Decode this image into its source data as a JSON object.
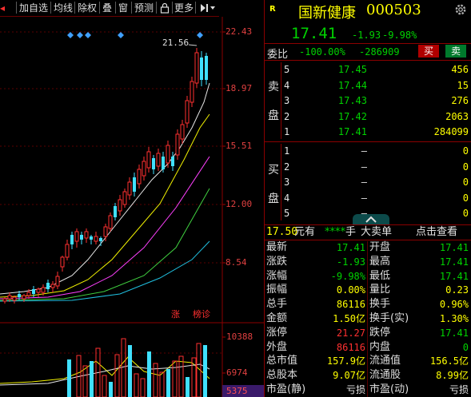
{
  "toolbar": {
    "items": [
      "加自选",
      "均线",
      "除权",
      "叠",
      "窗",
      "预测",
      "更多"
    ]
  },
  "chart": {
    "price_ticks": [
      "22.43",
      "18.97",
      "15.51",
      "12.00",
      "8.54"
    ],
    "volume_ticks": [
      "10388",
      "6974",
      "5375"
    ],
    "high_label": "21.56",
    "zhang_label": "涨",
    "bangzhen_label": "榜诊"
  },
  "header": {
    "badge": "R",
    "name": "国新健康",
    "code": "000503",
    "price": "17.41",
    "change": "-1.93",
    "change_pct": "-9.98%"
  },
  "weibi": {
    "label": "委比",
    "pct": "-100.00%",
    "diff": "-286909",
    "buy_btn": "买",
    "sell_btn": "卖"
  },
  "sell_side": {
    "label_1": "卖",
    "label_2": "盘",
    "levels": [
      {
        "lvl": "5",
        "price": "17.45",
        "vol": "456"
      },
      {
        "lvl": "4",
        "price": "17.44",
        "vol": "15"
      },
      {
        "lvl": "3",
        "price": "17.43",
        "vol": "276"
      },
      {
        "lvl": "2",
        "price": "17.42",
        "vol": "2063"
      },
      {
        "lvl": "1",
        "price": "17.41",
        "vol": "284099"
      }
    ]
  },
  "buy_side": {
    "label_1": "买",
    "label_2": "盘",
    "levels": [
      {
        "lvl": "1",
        "price": "–",
        "vol": "0"
      },
      {
        "lvl": "2",
        "price": "–",
        "vol": "0"
      },
      {
        "lvl": "3",
        "price": "–",
        "vol": "0"
      },
      {
        "lvl": "4",
        "price": "–",
        "vol": "0"
      },
      {
        "lvl": "5",
        "price": "–",
        "vol": "0"
      }
    ]
  },
  "order_bar": {
    "price": "17.50",
    "yuan": "元有",
    "stars": "****",
    "shou": "手",
    "big_order": "大卖单",
    "click": "点击查看"
  },
  "stats": [
    {
      "l1": "最新",
      "v1": "17.41",
      "c1": "grn",
      "l2": "开盘",
      "v2": "17.41",
      "c2": "grn"
    },
    {
      "l1": "涨跌",
      "v1": "-1.93",
      "c1": "grn",
      "l2": "最高",
      "v2": "17.41",
      "c2": "grn"
    },
    {
      "l1": "涨幅",
      "v1": "-9.98%",
      "c1": "grn",
      "l2": "最低",
      "v2": "17.41",
      "c2": "grn"
    },
    {
      "l1": "振幅",
      "v1": "0.00%",
      "c1": "yel",
      "l2": "量比",
      "v2": "0.23",
      "c2": "yel"
    },
    {
      "l1": "总手",
      "v1": "86116",
      "c1": "yel",
      "l2": "换手",
      "v2": "0.96%",
      "c2": "yel"
    },
    {
      "l1": "金额",
      "v1": "1.50亿",
      "c1": "yel",
      "l2": "换手(实)",
      "v2": "1.30%",
      "c2": "yel"
    },
    {
      "l1": "涨停",
      "v1": "21.27",
      "c1": "red",
      "l2": "跌停",
      "v2": "17.41",
      "c2": "grn"
    },
    {
      "l1": "外盘",
      "v1": "86116",
      "c1": "red",
      "l2": "内盘",
      "v2": "0",
      "c2": "grn"
    },
    {
      "l1": "总市值",
      "v1": "157.9亿",
      "c1": "yel",
      "l2": "流通值",
      "v2": "156.5亿",
      "c2": "yel"
    },
    {
      "l1": "总股本",
      "v1": "9.07亿",
      "c1": "yel",
      "l2": "流通股",
      "v2": "8.99亿",
      "c2": "yel"
    },
    {
      "l1": "市盈(静)",
      "v1": "亏损",
      "c1": "wht",
      "l2": "市盈(动)",
      "v2": "亏损",
      "c2": "wht"
    }
  ],
  "colors": {
    "up": "#ff3030",
    "down": "#00d200",
    "accent_cyan": "#00c8c8",
    "warn_yellow": "#ffff00"
  }
}
